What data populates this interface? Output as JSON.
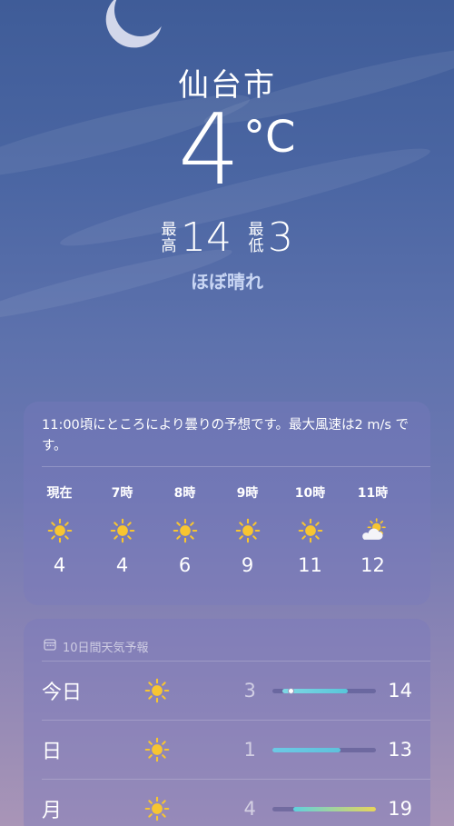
{
  "location": {
    "city": "仙台市"
  },
  "current": {
    "temperature": "4",
    "unit": "°C",
    "high_label": "最高",
    "high": "14",
    "low_label": "最低",
    "low": "3",
    "condition": "ほぼ晴れ"
  },
  "hourly": {
    "summary": "11:00頃にところにより曇りの予想です。最大風速は2 m/s です。",
    "items": [
      {
        "time": "現在",
        "icon": "sun-icon",
        "temp": "4"
      },
      {
        "time": "7時",
        "icon": "sun-icon",
        "temp": "4"
      },
      {
        "time": "8時",
        "icon": "sun-icon",
        "temp": "6"
      },
      {
        "time": "9時",
        "icon": "sun-icon",
        "temp": "9"
      },
      {
        "time": "10時",
        "icon": "sun-icon",
        "temp": "11"
      },
      {
        "time": "11時",
        "icon": "partly-cloudy-icon",
        "temp": "12"
      }
    ]
  },
  "forecast": {
    "title": "10日間天気予報",
    "icon": "calendar-icon",
    "days": [
      {
        "day": "今日",
        "icon": "sun-icon",
        "low": "3",
        "high": "14",
        "range": [
          0.1,
          0.73
        ],
        "current_marker": 0.18,
        "colors": [
          "#7fd7e4",
          "#58c6d9"
        ]
      },
      {
        "day": "日",
        "icon": "sun-icon",
        "low": "1",
        "high": "13",
        "range": [
          0.0,
          0.66
        ],
        "colors": [
          "#6cc9e5",
          "#5ec2dc"
        ]
      },
      {
        "day": "月",
        "icon": "sun-icon",
        "low": "4",
        "high": "19",
        "range": [
          0.2,
          1.0
        ],
        "colors": [
          "#5fd1de",
          "#e8d55a"
        ]
      }
    ]
  },
  "colors": {
    "sun": "#f7c531",
    "accent_text": "#c9d6f4"
  }
}
